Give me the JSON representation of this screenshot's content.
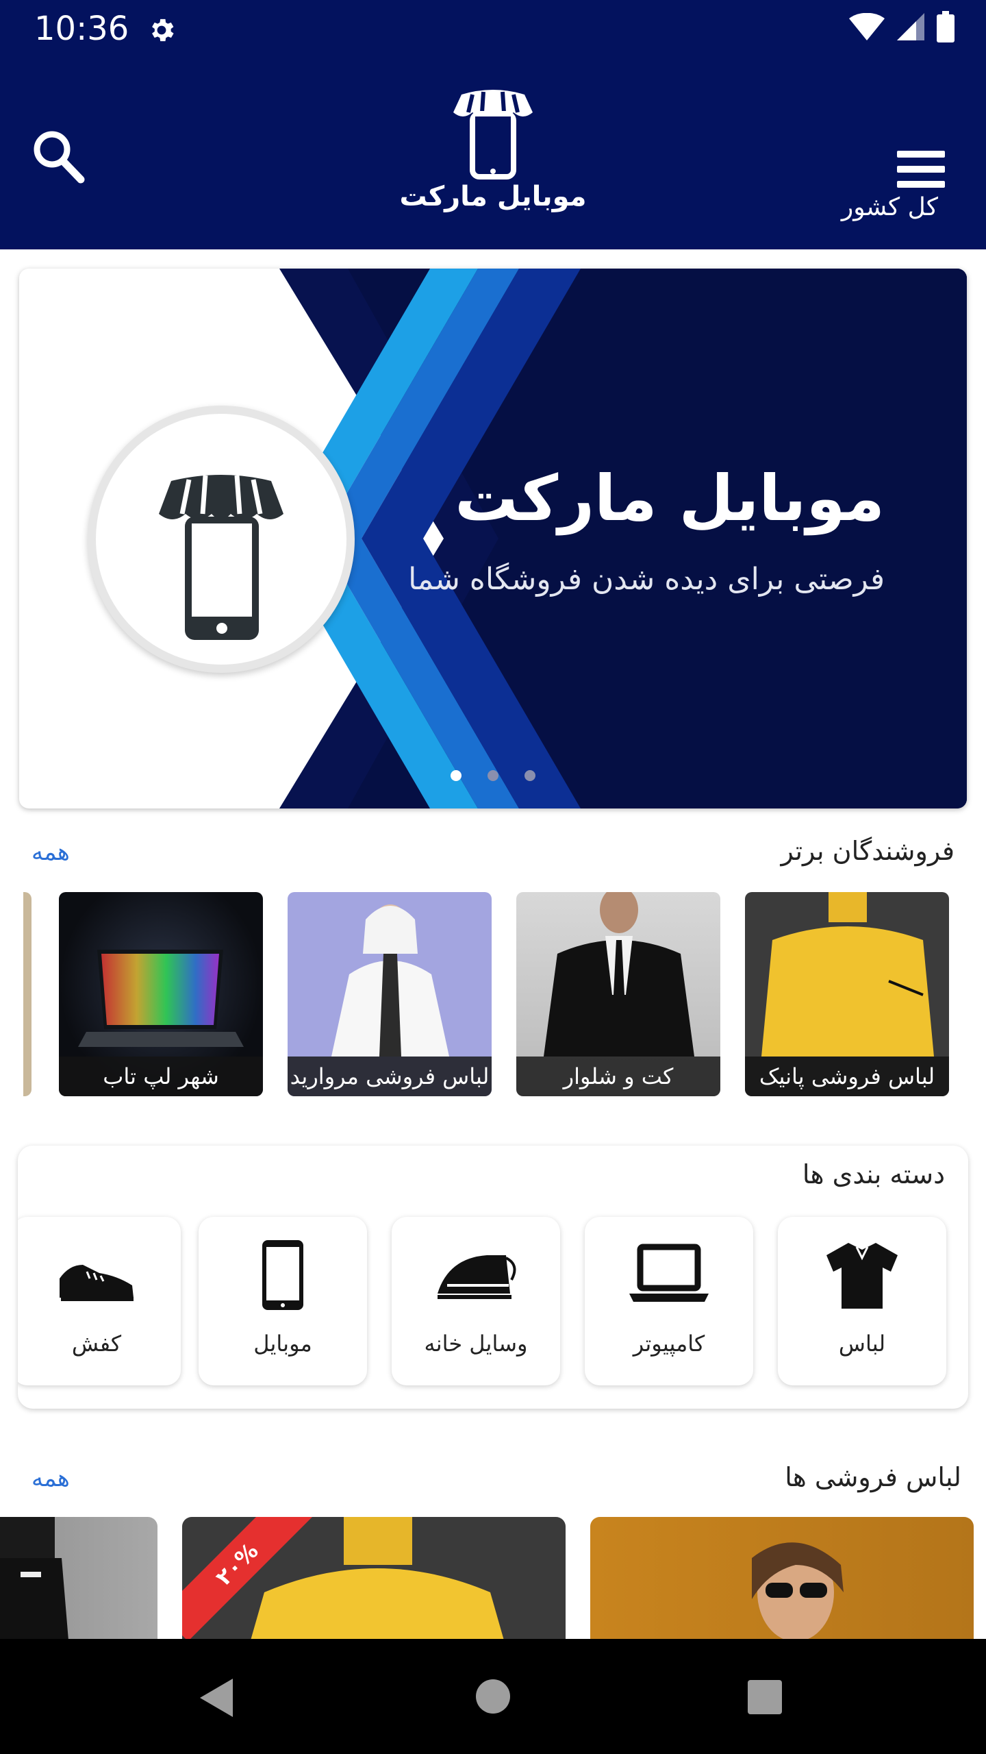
{
  "status_bar": {
    "time": "10:36"
  },
  "app_bar": {
    "title": "موبایل مارکت",
    "region": "کل کشور",
    "menu_icon": "hamburger-icon",
    "search_icon": "search-icon"
  },
  "banner": {
    "title": "موبایل مارکت",
    "subtitle": "فرصتی برای دیده شدن فروشگاه شما",
    "slides_count": 3,
    "active_slide": 1
  },
  "top_sellers": {
    "title": "فروشندگان برتر",
    "all_label": "همه",
    "items": [
      {
        "label": "لباس فروشی پانیک"
      },
      {
        "label": "کت و شلوار"
      },
      {
        "label": "لباس فروشی مروارید"
      },
      {
        "label": "شهر لپ تاب"
      }
    ]
  },
  "categories": {
    "title": "دسته بندی ها",
    "items": [
      {
        "label": "لباس",
        "icon": "shirt-icon"
      },
      {
        "label": "کامپیوتر",
        "icon": "laptop-icon"
      },
      {
        "label": "وسایل خانه",
        "icon": "iron-icon"
      },
      {
        "label": "موبایل",
        "icon": "mobile-icon"
      },
      {
        "label": "کفش",
        "icon": "shoe-icon"
      }
    ]
  },
  "clothing_stores": {
    "title": "لباس فروشی ها",
    "all_label": "همه",
    "discount_badge": "۲۰%"
  },
  "colors": {
    "primary": "#03125e",
    "link": "#2a6fd6",
    "badge": "#e5302f"
  }
}
